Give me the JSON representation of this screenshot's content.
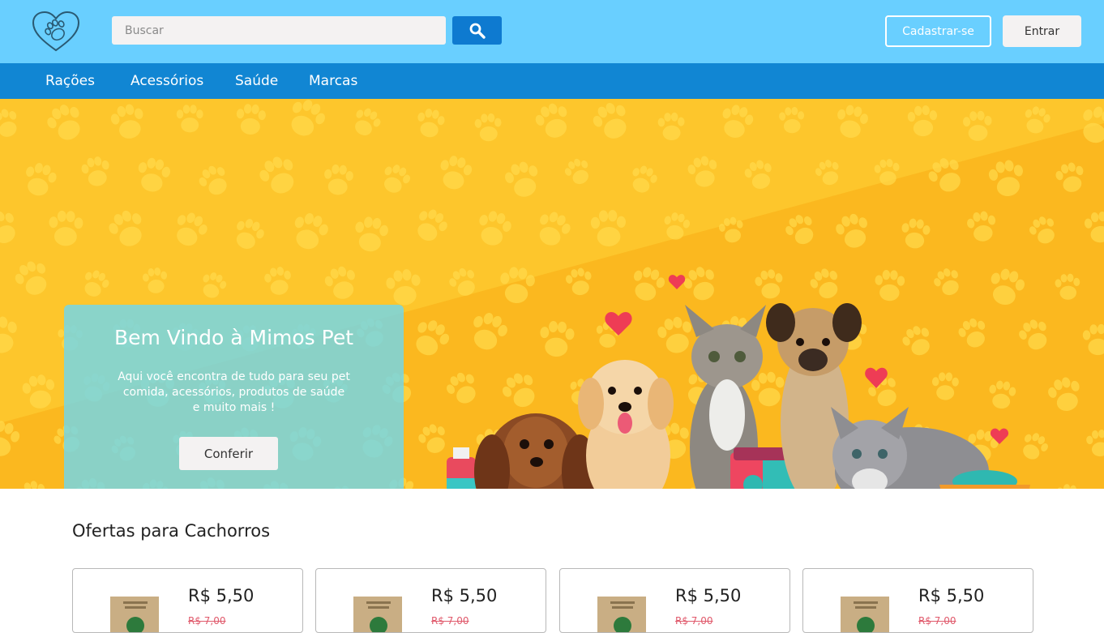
{
  "header": {
    "logo_icon": "heart-paw-icon",
    "search": {
      "placeholder": "Buscar",
      "value": "",
      "icon": "search-icon"
    },
    "signup_label": "Cadastrar-se",
    "login_label": "Entrar"
  },
  "nav": {
    "items": [
      {
        "label": "Rações"
      },
      {
        "label": "Acessórios"
      },
      {
        "label": "Saúde"
      },
      {
        "label": "Marcas"
      }
    ]
  },
  "hero": {
    "title": "Bem Vindo à Mimos Pet",
    "description": "Aqui você encontra de tudo para seu pet\ncomida, acessórios, produtos de saúde\ne muito mais !",
    "cta_label": "Conferir",
    "image": "puppies-kittens-illustration"
  },
  "offers": {
    "title": "Ofertas para Cachorros",
    "products": [
      {
        "price": "R$ 5,50",
        "old_price": "R$ 7,00"
      },
      {
        "price": "R$ 5,50",
        "old_price": "R$ 7,00"
      },
      {
        "price": "R$ 5,50",
        "old_price": "R$ 7,00"
      },
      {
        "price": "R$ 5,50",
        "old_price": "R$ 7,00"
      }
    ]
  },
  "colors": {
    "topbar": "#69cfff",
    "navbar": "#1186d3",
    "search_button": "#0e7ad0",
    "hero_background": "#fbb81f",
    "welcome_panel": "#70d7eb",
    "old_price": "#e05a6c"
  }
}
